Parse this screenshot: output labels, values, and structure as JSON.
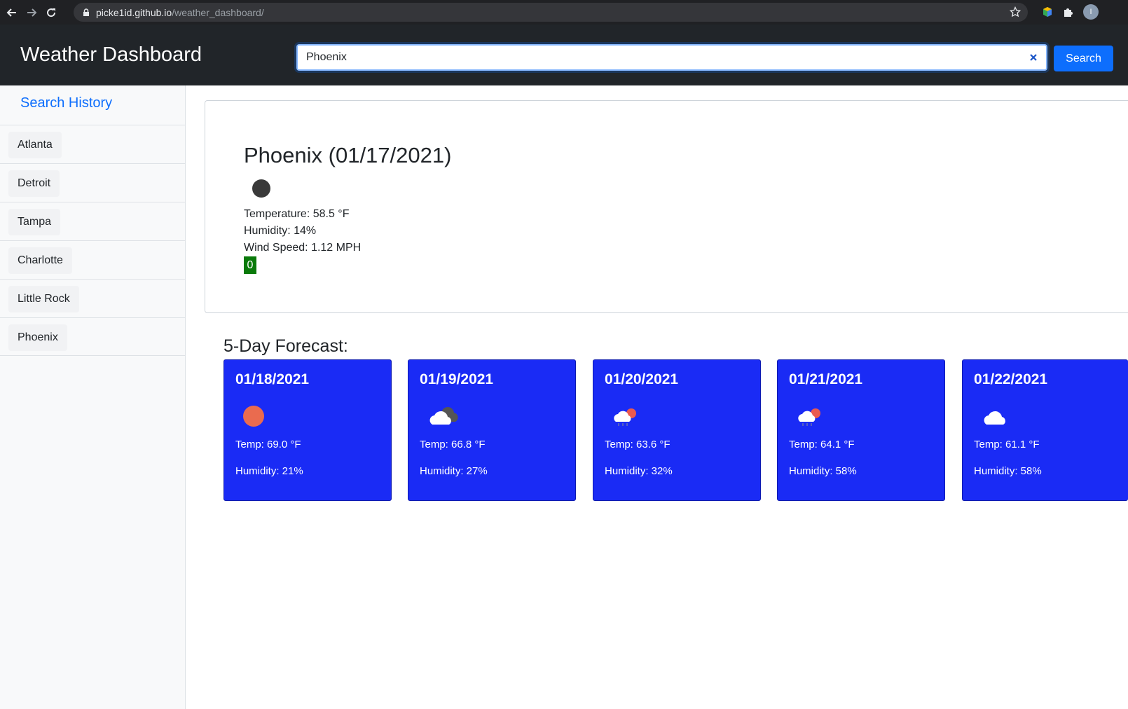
{
  "browser": {
    "url_host": "picke1id.github.io",
    "url_path": "/weather_dashboard/",
    "profile_initial": "I"
  },
  "header": {
    "title": "Weather Dashboard",
    "search_value": "Phoenix",
    "search_button": "Search"
  },
  "sidebar": {
    "title": "Search History",
    "items": [
      {
        "label": "Atlanta"
      },
      {
        "label": "Detroit"
      },
      {
        "label": "Tampa"
      },
      {
        "label": "Charlotte"
      },
      {
        "label": "Little Rock"
      },
      {
        "label": "Phoenix"
      }
    ]
  },
  "current": {
    "title": "Phoenix (01/17/2021)",
    "icon": "clear-night-icon",
    "temperature": "Temperature: 58.5 °F",
    "humidity": "Humidity: 14%",
    "wind": "Wind Speed: 1.12 MPH",
    "uv_index": "0",
    "uv_color": "#0a7a0a"
  },
  "forecast": {
    "title": "5-Day Forecast:",
    "card_color": "#1a2bf5",
    "days": [
      {
        "date": "01/18/2021",
        "icon": "sun-icon",
        "temp": "Temp: 69.0 °F",
        "humidity": "Humidity: 21%"
      },
      {
        "date": "01/19/2021",
        "icon": "cloudy-icon",
        "temp": "Temp: 66.8 °F",
        "humidity": "Humidity: 27%"
      },
      {
        "date": "01/20/2021",
        "icon": "rain-sun-icon",
        "temp": "Temp: 63.6 °F",
        "humidity": "Humidity: 32%"
      },
      {
        "date": "01/21/2021",
        "icon": "rain-sun-icon",
        "temp": "Temp: 64.1 °F",
        "humidity": "Humidity: 58%"
      },
      {
        "date": "01/22/2021",
        "icon": "cloud-icon",
        "temp": "Temp: 61.1 °F",
        "humidity": "Humidity: 58%"
      }
    ]
  }
}
